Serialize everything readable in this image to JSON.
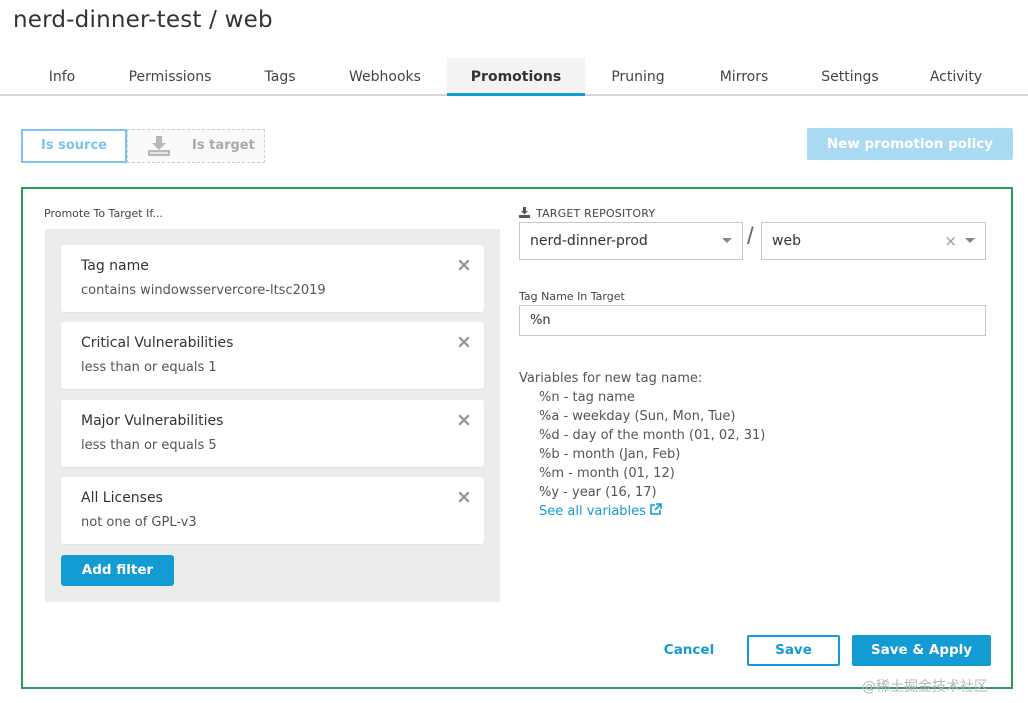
{
  "header": {
    "title": "nerd-dinner-test / web"
  },
  "tabs": [
    {
      "label": "Info"
    },
    {
      "label": "Permissions"
    },
    {
      "label": "Tags"
    },
    {
      "label": "Webhooks"
    },
    {
      "label": "Promotions",
      "active": true
    },
    {
      "label": "Pruning"
    },
    {
      "label": "Mirrors"
    },
    {
      "label": "Settings"
    },
    {
      "label": "Activity"
    }
  ],
  "toolbar": {
    "is_source_label": "Is source",
    "is_target_label": "Is target",
    "new_policy_label": "New promotion policy"
  },
  "policy": {
    "promote_label": "Promote To Target If...",
    "filters": [
      {
        "name": "Tag name",
        "condition": "contains windowsservercore-ltsc2019"
      },
      {
        "name": "Critical Vulnerabilities",
        "condition": "less than or equals 1"
      },
      {
        "name": "Major Vulnerabilities",
        "condition": "less than or equals 5"
      },
      {
        "name": "All Licenses",
        "condition": "not one of GPL-v3"
      }
    ],
    "add_filter_label": "Add filter",
    "target_repo_label": "TARGET REPOSITORY",
    "target_namespace": "nerd-dinner-prod",
    "repo_separator": "/",
    "target_repo": "web",
    "clear_symbol": "×",
    "tag_name_label": "Tag Name In Target",
    "tag_name_value": "%n",
    "variables_title": "Variables for new tag name:",
    "variables": [
      "%n - tag name",
      "%a - weekday (Sun, Mon, Tue)",
      "%d - day of the month (01, 02, 31)",
      "%b - month (Jan, Feb)",
      "%m - month (01, 12)",
      "%y - year (16, 17)"
    ],
    "see_all_label": "See all variables",
    "cancel_label": "Cancel",
    "save_label": "Save",
    "save_apply_label": "Save & Apply"
  },
  "watermark": "@稀土掘金技术社区",
  "colors": {
    "accent": "#139bd4",
    "accent_light": "#a9daf2",
    "panel_border": "#2a9d5c"
  },
  "icons": {
    "is_target": "download-icon",
    "target_repo": "download-icon",
    "remove_filter": "close-icon",
    "see_all": "external-link-icon"
  }
}
